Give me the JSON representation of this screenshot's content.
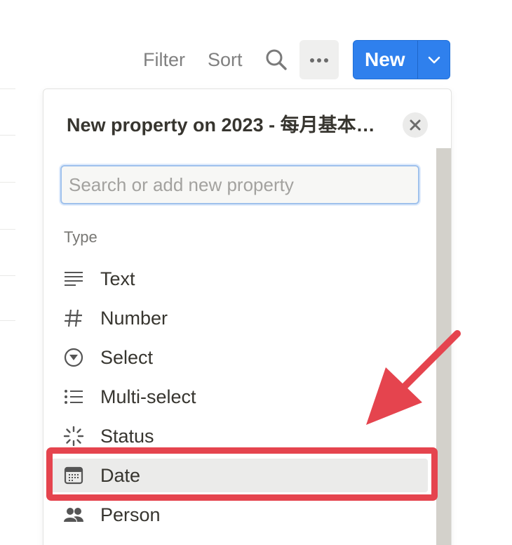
{
  "toolbar": {
    "filter_label": "Filter",
    "sort_label": "Sort",
    "search_icon": "search-icon",
    "more_icon": "more-horizontal-icon",
    "new_label": "New",
    "new_dropdown_icon": "chevron-down-icon"
  },
  "panel": {
    "title": "New property on 2023 - 每月基本…",
    "close_icon": "close-icon",
    "search": {
      "placeholder": "Search or add new property",
      "value": ""
    },
    "section_label": "Type",
    "items": [
      {
        "label": "Text",
        "icon": "text-lines-icon",
        "active": false
      },
      {
        "label": "Number",
        "icon": "hash-icon",
        "active": false
      },
      {
        "label": "Select",
        "icon": "select-circle-icon",
        "active": false
      },
      {
        "label": "Multi-select",
        "icon": "list-icon",
        "active": false
      },
      {
        "label": "Status",
        "icon": "status-loader-icon",
        "active": false
      },
      {
        "label": "Date",
        "icon": "calendar-icon",
        "active": true
      },
      {
        "label": "Person",
        "icon": "people-icon",
        "active": false
      }
    ]
  },
  "colors": {
    "accent_blue": "#2f80ed",
    "annotation_red": "#e5444e",
    "text": "#37352f",
    "muted_text": "#787774"
  }
}
